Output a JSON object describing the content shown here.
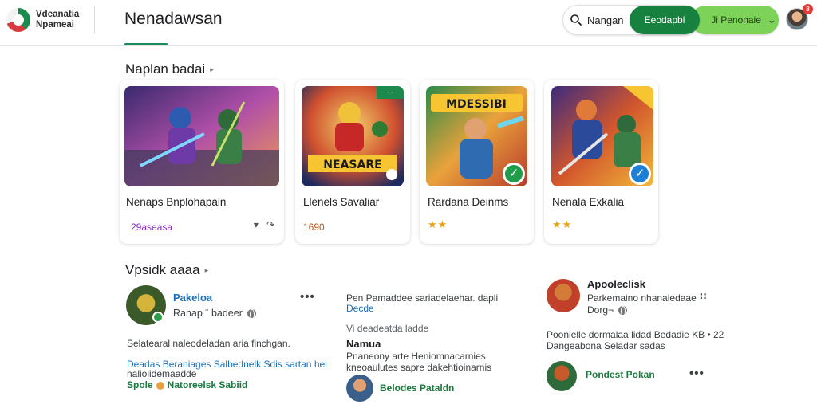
{
  "header": {
    "logo_line1": "Vdeanatia",
    "logo_line2": "Npameai",
    "title": "Nenadawsan",
    "search_text": "Nangan",
    "primary_button": "Eeodapbl",
    "secondary_button": "Jі Penonaie",
    "notification_count": "8"
  },
  "featured": {
    "heading": "Naplan badai",
    "cards": [
      {
        "title": "Nenaps Bnplohapain",
        "meta": "29aseasa",
        "art_text": ""
      },
      {
        "title": "Llenels Savaliar",
        "meta": "1690",
        "art_text": "NEASARE",
        "corner_tag": "—"
      },
      {
        "title": "Rardana Deinms",
        "rating": "★★",
        "art_text": "MDESSIBI"
      },
      {
        "title": "Nenala Exkalia",
        "rating": "★★",
        "art_text": ""
      }
    ]
  },
  "recent": {
    "heading": "Vpsidk aaaa",
    "posts": [
      {
        "name": "Pakeloa",
        "sub": "Ranap ¨ badeer",
        "line1": "Selatearal naleodeladan aria finchgan.",
        "line2": "Deadas Beraniages Salbednelk Sdis sartan hei",
        "line3": "naliolidemaadde",
        "line4_a": "Spole",
        "line4_b": "Natoreelsk Sabiid"
      },
      {
        "line1": "Pen Pamaddee sariadelaehar. dapli",
        "line2": "Decde",
        "line3": "Vi deadeatda ladde",
        "name": "Namua",
        "line4": "Pnaneony arte Heniomnacarnies",
        "line5": "kneoaulutes sapre dakehtioinarnis",
        "footer": "Belodes Pataldn"
      },
      {
        "name": "Apooleclisk",
        "sub1": "Parkemaino nhanaledaae",
        "sub2": "Dorg¬",
        "line1": "Poonielle dormalaa lidad Bedadie KB  • 22",
        "line2": "Dangeabona Seladar sadas",
        "footer": "Pondest Pokan"
      }
    ]
  },
  "colors": {
    "brand_green": "#17813f",
    "accent_lime": "#7dd35a",
    "link_blue": "#1a6fb8",
    "badge_red": "#e53935"
  }
}
